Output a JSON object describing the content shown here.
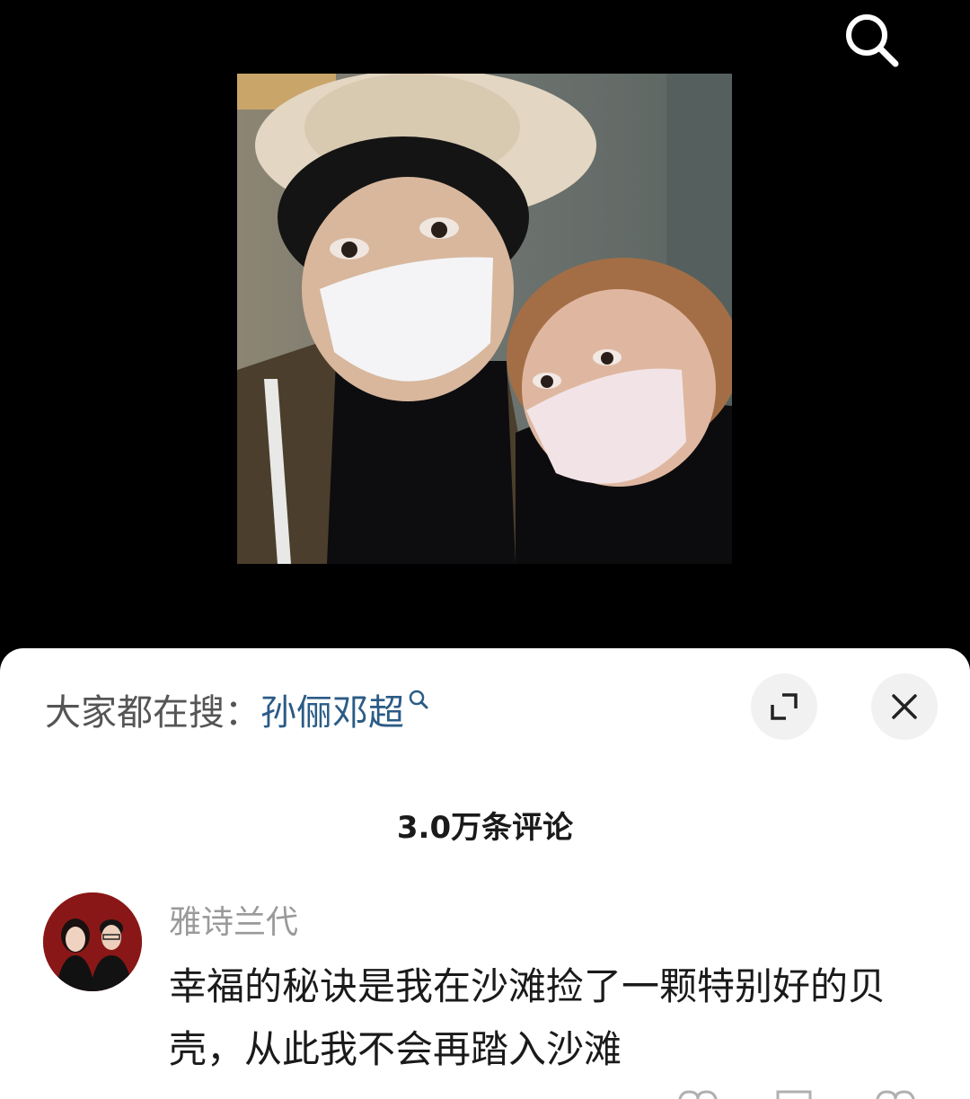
{
  "header": {
    "search_icon": "search-icon"
  },
  "comments_sheet": {
    "hot_search": {
      "prefix": "大家都在搜：",
      "term": "孙俪邓超",
      "term_icon": "search-icon"
    },
    "expand_icon": "expand-icon",
    "close_icon": "close-icon",
    "comment_count_title": "3.0万条评论",
    "comments": [
      {
        "username": "雅诗兰代",
        "text": "幸福的秘诀是我在沙滩捡了一颗特别好的贝壳，从此我不会再踏入沙滩"
      }
    ]
  }
}
